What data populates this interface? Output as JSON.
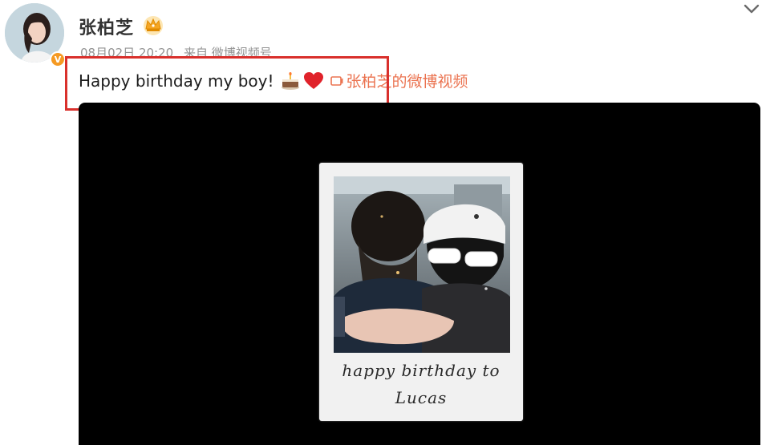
{
  "post": {
    "username": "张柏芝",
    "verified_mark": "V",
    "meta": {
      "date_time": "08月02日 20:20",
      "source": "来自 微博视频号"
    },
    "text": "Happy birthday my boy!",
    "emojis": [
      "cake-icon",
      "heart-icon"
    ],
    "video_link_label": "张柏芝的微博视频",
    "highlight_color": "#d9302c",
    "link_color": "#eb7350"
  },
  "video": {
    "background": "#000000",
    "caption_line1": "happy birthday to",
    "caption_line2": "Lucas"
  }
}
